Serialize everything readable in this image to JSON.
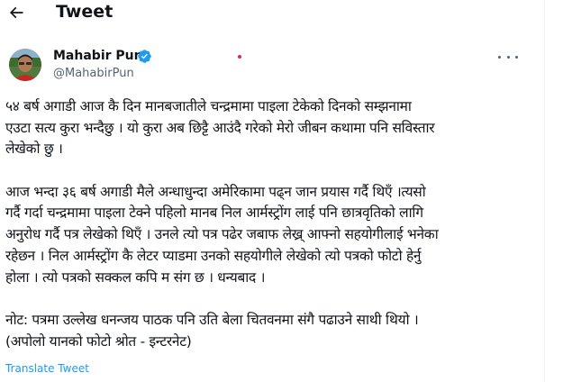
{
  "header": {
    "title": "Tweet",
    "back_icon": "arrow-left-icon"
  },
  "author": {
    "name": "Mahabir Pun",
    "handle": "@MahabirPun",
    "verified_icon": "verified-badge-icon",
    "avatar_icon": "avatar-photo"
  },
  "tweet": {
    "paragraphs": [
      [
        "५४ बर्ष अगाडी आज कै दिन मानबजातीले चन्द्रमामा पाइला टेकेको दिनको सम्झनामा",
        "एउटा सत्य कुरा भन्दैछु । यो कुरा अब छिट्टै आउंदै गरेको मेरो जीबन कथामा पनि सविस्तार",
        "लेखेको छु ।"
      ],
      [
        "आज भन्दा ३६ बर्ष अगाडी मैले अन्धाधुन्दा अमेरिकामा पढ्न जान प्रयास गर्दै थिएँ ।त्यसो",
        "गर्दै गर्दा  चन्द्रमामा पाइला टेक्ने पहिलो मानब निल आर्मस्ट्रोंग लाई पनि छात्रवृतिको लागि",
        "अनुरोध गर्दै पत्र लेखेको थिएँ । उनले त्यो पत्र पढेर जबाफ लेख्र् आफ्नो सहयोगीलाई भनेका",
        "रहेछन ।  निल आर्मस्ट्रोंग कै लेटर प्याडमा उनको सहयोगीले लेखेको त्यो पत्रको फोटो हेर्नु",
        "होला । त्यो पत्रको सक्कल कपि म संग छ । धन्यबाद ।"
      ],
      [
        "नोट: पत्रमा उल्लेख धनन्जय पाठक पनि उति बेला चितवनमा संगै पढाउने साथी थियो ।",
        "(अपोलो यानको फोटो श्रोत - इन्टरनेट)"
      ]
    ],
    "translate_label": "Translate Tweet"
  },
  "colors": {
    "accent": "#1d9bf0",
    "text": "#0f1419",
    "muted": "#536471"
  }
}
